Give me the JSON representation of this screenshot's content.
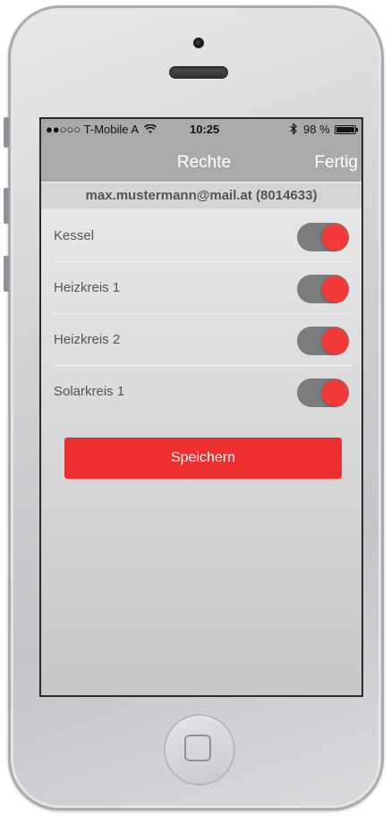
{
  "status_bar": {
    "carrier": "●●○○○ T-Mobile A",
    "time": "10:25",
    "battery": "98 %"
  },
  "nav": {
    "title": "Rechte",
    "done_label": "Fertig"
  },
  "account": "max.mustermann@mail.at (8014633)",
  "permissions": [
    {
      "label": "Kessel",
      "enabled": true
    },
    {
      "label": "Heizkreis 1",
      "enabled": true
    },
    {
      "label": "Heizkreis 2",
      "enabled": true
    },
    {
      "label": "Solarkreis 1",
      "enabled": true
    }
  ],
  "save_label": "Speichern",
  "colors": {
    "accent": "#ee2f30",
    "toggle_track": "#7b7c7e",
    "nav_bg": "#a9aaac"
  }
}
